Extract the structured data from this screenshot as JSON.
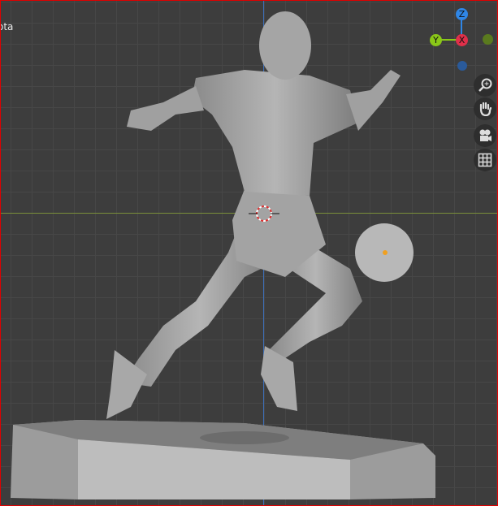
{
  "viewport": {
    "object_label": "ota"
  },
  "gizmo": {
    "x_label": "X",
    "y_label": "Y",
    "z_label": "Z",
    "colors": {
      "x": "#e0304a",
      "y": "#8ac718",
      "z": "#2f86e6",
      "neg_y": "#5a7a1e",
      "neg_z": "#2a5a9a"
    }
  },
  "nav_buttons": [
    {
      "icon": "zoom-icon"
    },
    {
      "icon": "hand-pan-icon"
    },
    {
      "icon": "camera-icon"
    },
    {
      "icon": "grid-ortho-icon"
    }
  ]
}
